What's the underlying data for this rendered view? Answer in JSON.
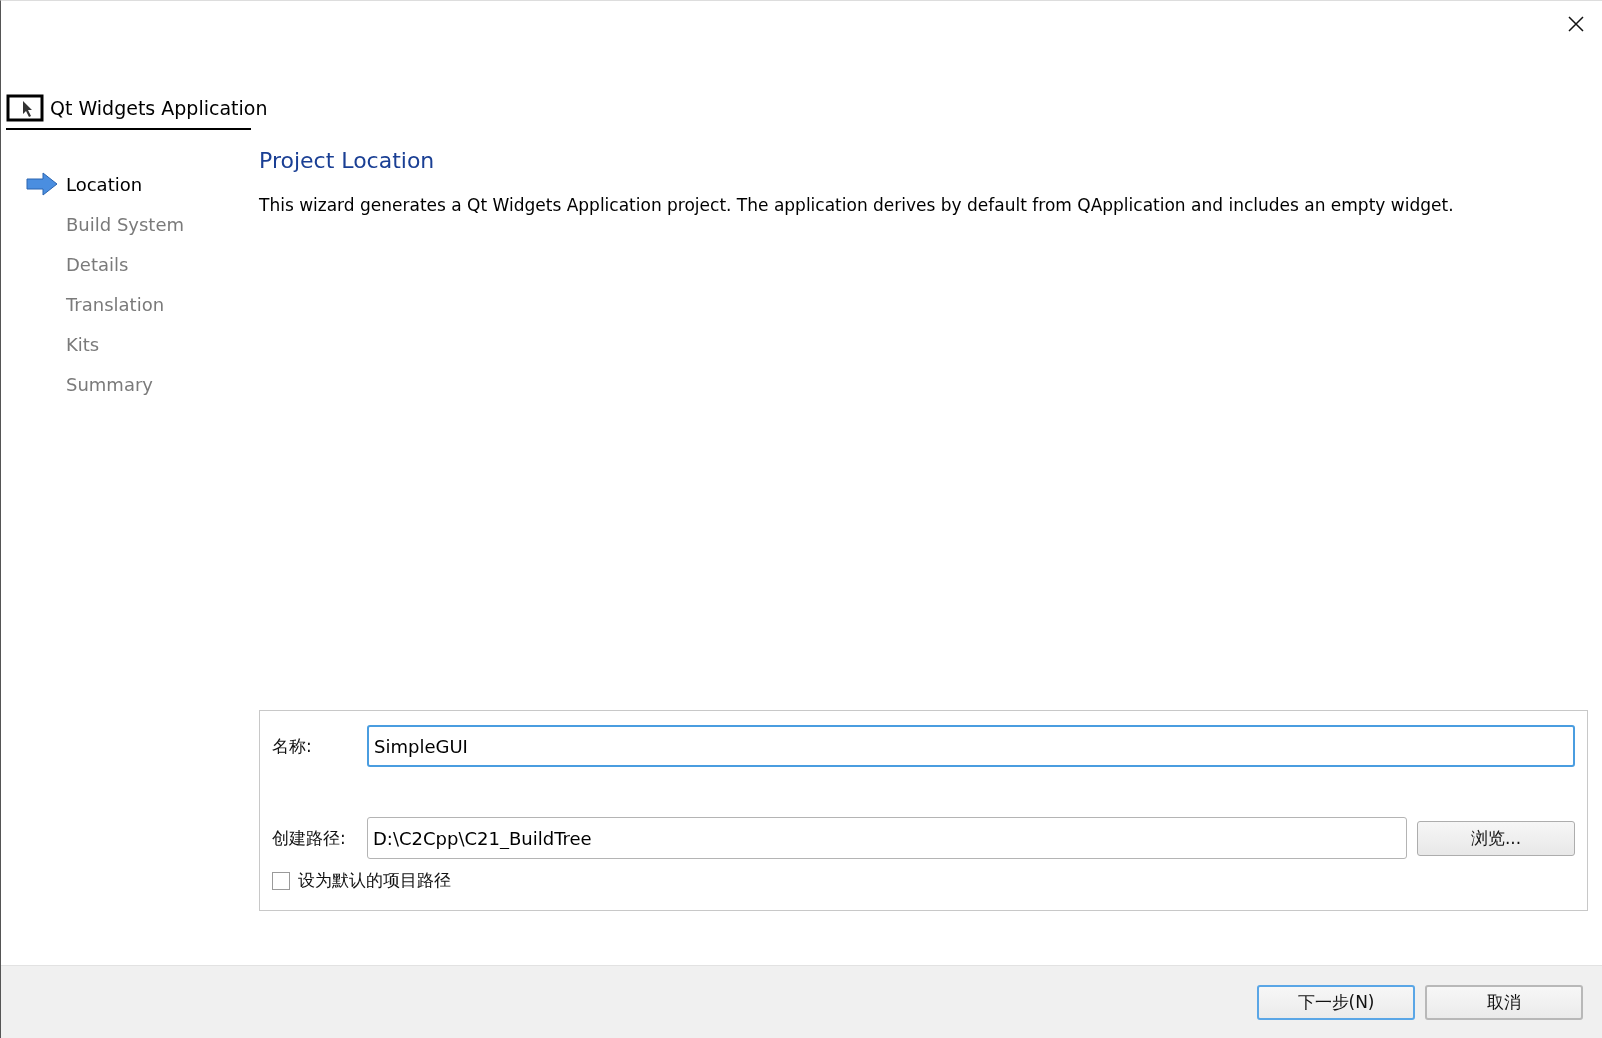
{
  "wizard_title": "Qt Widgets Application",
  "steps": [
    {
      "label": "Location",
      "selected": true
    },
    {
      "label": "Build System",
      "selected": false
    },
    {
      "label": "Details",
      "selected": false
    },
    {
      "label": "Translation",
      "selected": false
    },
    {
      "label": "Kits",
      "selected": false
    },
    {
      "label": "Summary",
      "selected": false
    }
  ],
  "page": {
    "heading": "Project Location",
    "description": "This wizard generates a Qt Widgets Application project. The application derives by default from QApplication and includes an empty widget."
  },
  "form": {
    "name_label": "名称:",
    "name_value": "SimpleGUI",
    "name_focused": true,
    "path_label": "创建路径:",
    "path_value": "D:\\C2Cpp\\C21_BuildTree",
    "browse_button": "浏览...",
    "default_checkbox": {
      "label": "设为默认的项目路径",
      "checked": false
    }
  },
  "buttons": [
    {
      "label": "下一步(N)",
      "kind": "default"
    },
    {
      "label": "取消",
      "kind": "normal"
    }
  ]
}
